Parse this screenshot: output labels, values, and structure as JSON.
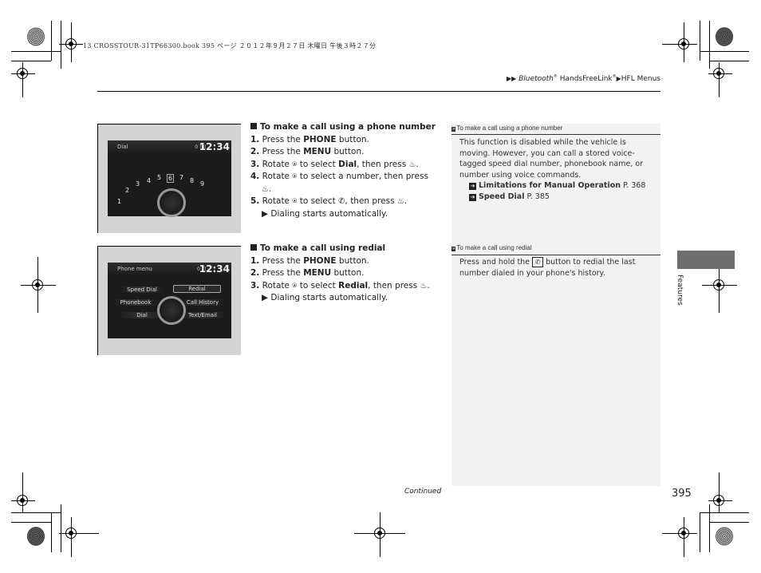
{
  "print_slug": "13 CROSSTOUR-31TP66300.book  395 ページ  ２０１２年９月２７日  木曜日  午後３時２７分",
  "breadcrumb": {
    "items": [
      "Bluetooth",
      "HandsFreeLink",
      "HFL Menus"
    ],
    "registered_mark": "®"
  },
  "sections": [
    {
      "heading": "To make a call using a phone number",
      "screen": {
        "title": "Dial",
        "status": "0 Tal",
        "clock": "12:34",
        "digits": [
          "1",
          "2",
          "3",
          "4",
          "5",
          "6",
          "7",
          "8",
          "9"
        ],
        "selected_digit": "6"
      },
      "steps": [
        {
          "num": "1.",
          "pre": "Press the ",
          "bold": "PHONE",
          "post": " button."
        },
        {
          "num": "2.",
          "pre": "Press the ",
          "bold": "MENU",
          "post": " button."
        },
        {
          "num": "3.",
          "pre": "Rotate ",
          "mid": " to select ",
          "bold": "Dial",
          "post": ", then press "
        },
        {
          "num": "4.",
          "pre": "Rotate ",
          "mid": " to select a number, then press"
        },
        {
          "num": "5.",
          "pre": "Rotate ",
          "mid": " to select ",
          "post": ", then press "
        }
      ],
      "result": "Dialing starts automatically.",
      "sidenote": {
        "heading": "To make a call using a phone number",
        "body": "This function is disabled while the vehicle is moving. However, you can call a stored voice-tagged speed dial number, phonebook name, or number using voice commands.",
        "links": [
          {
            "label": "Limitations for Manual Operation",
            "page": "P. 368"
          },
          {
            "label": "Speed Dial",
            "page": "P. 385"
          }
        ]
      }
    },
    {
      "heading": "To make a call using redial",
      "screen": {
        "title": "Phone menu",
        "status": "0 Tl",
        "clock": "12:34",
        "menu_left": [
          "Speed Dial",
          "Phonebook",
          "Dial"
        ],
        "menu_right": [
          "Redial",
          "Call History",
          "Text/Email"
        ],
        "selected_item": "Redial"
      },
      "steps": [
        {
          "num": "1.",
          "pre": "Press the ",
          "bold": "PHONE",
          "post": " button."
        },
        {
          "num": "2.",
          "pre": "Press the ",
          "bold": "MENU",
          "post": " button."
        },
        {
          "num": "3.",
          "pre": "Rotate ",
          "mid": " to select ",
          "bold": "Redial",
          "post": ", then press "
        }
      ],
      "result": "Dialing starts automatically.",
      "sidenote": {
        "heading": "To make a call using redial",
        "body_pre": "Press and hold the ",
        "body_post": " button to redial the last number dialed in your phone's history."
      }
    }
  ],
  "icons": {
    "interface_dial": "⍟",
    "press_dial": "♨",
    "pickup": "✆",
    "triangle": "▶",
    "double_arrow": "»",
    "link_arrow": "➔"
  },
  "side_tab": {
    "label": "Features",
    "color": "#6e6e6e"
  },
  "footer": {
    "continued": "Continued",
    "page_number": "395"
  }
}
